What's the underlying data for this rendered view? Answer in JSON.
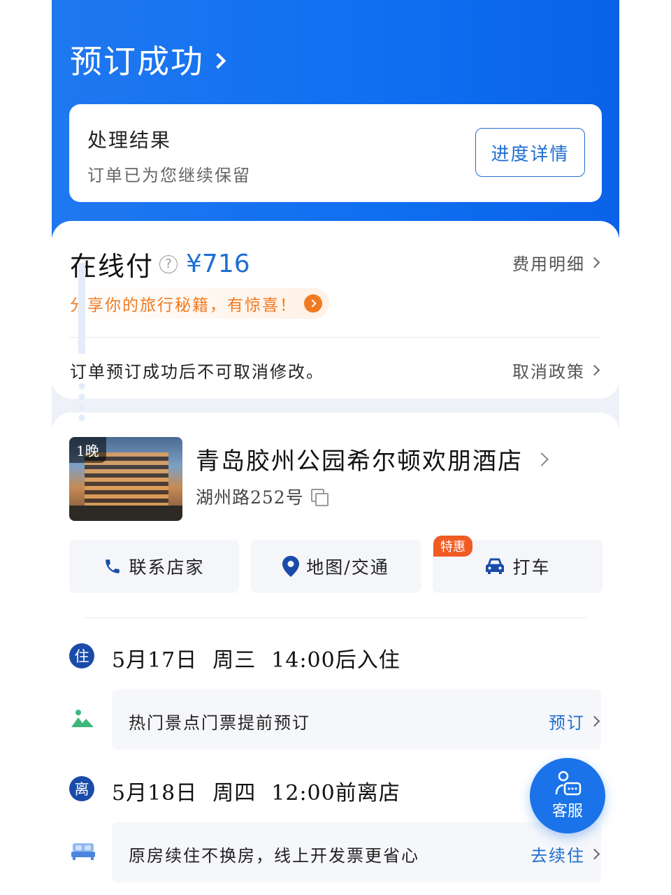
{
  "header": {
    "title": "预订成功"
  },
  "result": {
    "title": "处理结果",
    "desc": "订单已为您继续保留",
    "button": "进度详情"
  },
  "payment": {
    "label": "在线付",
    "price": "¥716",
    "fee_link": "费用明细",
    "promo": "分享你的旅行秘籍，有惊喜！",
    "policy_text": "订单预订成功后不可取消修改。",
    "policy_link": "取消政策"
  },
  "hotel": {
    "nights": "1晚",
    "name": "青岛胶州公园希尔顿欢朋酒店",
    "address": "湖州路252号"
  },
  "actions": {
    "contact": "联系店家",
    "map": "地图/交通",
    "taxi": "打车",
    "deal_badge": "特惠"
  },
  "checkin": {
    "badge": "住",
    "date": "5月17日",
    "weekday": "周三",
    "time": "14:00后入住"
  },
  "tickets": {
    "text": "热门景点门票提前预订",
    "link": "预订"
  },
  "checkout": {
    "badge": "离",
    "date": "5月18日",
    "weekday": "周四",
    "time": "12:00前离店"
  },
  "extend": {
    "text": "原房续住不换房，线上开发票更省心",
    "link": "去续住"
  },
  "service": {
    "label": "客服"
  },
  "colors": {
    "brand_blue": "#1a73e8",
    "accent_orange": "#f07a20",
    "badge_navy": "#1a4ba8"
  }
}
